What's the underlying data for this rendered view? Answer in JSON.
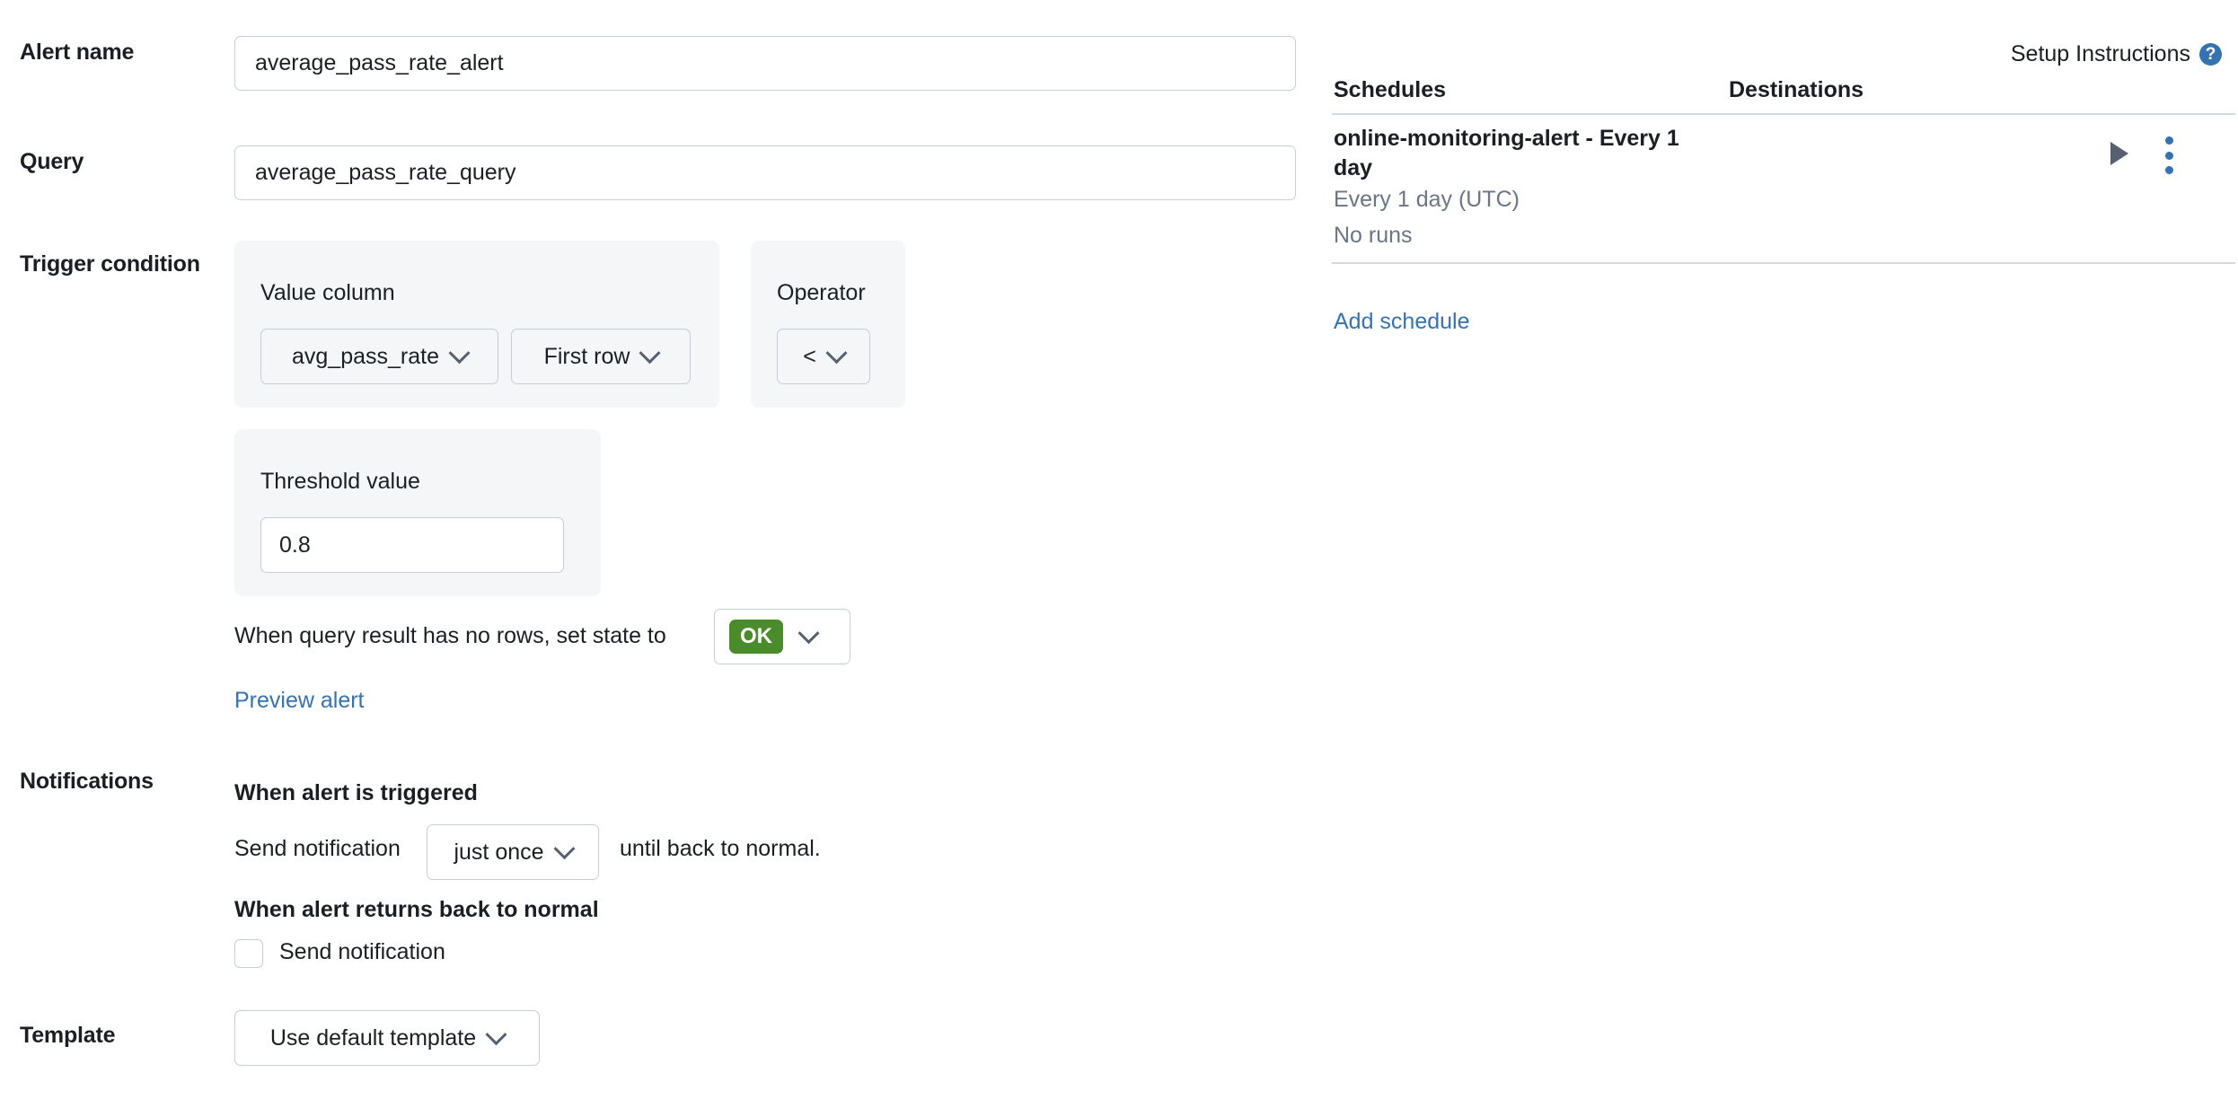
{
  "form": {
    "alert_name": {
      "label": "Alert name",
      "value": "average_pass_rate_alert"
    },
    "query": {
      "label": "Query",
      "value": "average_pass_rate_query"
    },
    "trigger_condition": {
      "label": "Trigger condition",
      "value_column_label": "Value column",
      "value_column_value": "avg_pass_rate",
      "aggregation_value": "First row",
      "operator_label": "Operator",
      "operator_value": "<",
      "threshold_label": "Threshold value",
      "threshold_value": "0.8",
      "no_rows_text": "When query result has no rows, set state to",
      "no_rows_state": "OK",
      "preview_link": "Preview alert"
    },
    "notifications": {
      "label": "Notifications",
      "when_triggered_heading": "When alert is triggered",
      "send_notification_prefix": "Send notification",
      "frequency_value": "just once",
      "send_notification_suffix": "until back to normal.",
      "when_normal_heading": "When alert returns back to normal",
      "send_notification_checkbox_label": "Send notification",
      "send_notification_checked": false
    },
    "template": {
      "label": "Template",
      "value": "Use default template"
    }
  },
  "right_panel": {
    "setup_instructions": "Setup Instructions",
    "help_icon": "question-mark-circle-icon",
    "columns": {
      "schedules": "Schedules",
      "destinations": "Destinations"
    },
    "schedule": {
      "title": "online-monitoring-alert - Every 1 day",
      "cadence": "Every 1 day (UTC)",
      "runs": "No runs",
      "run_icon": "play-icon",
      "menu_icon": "kebab-menu-icon"
    },
    "add_schedule_link": "Add schedule"
  },
  "colors": {
    "link": "#3573b0",
    "ok_badge": "#4a8b2c",
    "panel_bg": "#f5f6f8",
    "border": "#c5cdd8",
    "muted_text": "#6b7684"
  }
}
